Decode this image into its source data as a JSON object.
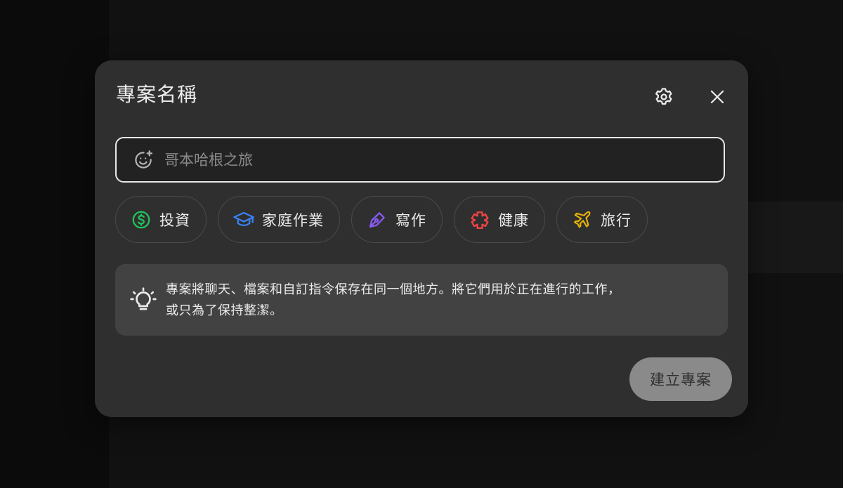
{
  "dialog": {
    "title": "專案名稱",
    "settings_icon": "gear-icon",
    "close_icon": "close-icon"
  },
  "name_field": {
    "value": "",
    "placeholder": "哥本哈根之旅",
    "emoji_icon": "smiley-add-icon"
  },
  "categories": [
    {
      "label": "投資",
      "icon": "dollar-circle-icon",
      "color": "#22c55e"
    },
    {
      "label": "家庭作業",
      "icon": "graduation-cap-icon",
      "color": "#3b82f6"
    },
    {
      "label": "寫作",
      "icon": "pen-nib-icon",
      "color": "#8b5cf6"
    },
    {
      "label": "健康",
      "icon": "medical-cross-icon",
      "color": "#ef4444"
    },
    {
      "label": "旅行",
      "icon": "airplane-icon",
      "color": "#eab308"
    }
  ],
  "info": {
    "icon": "lightbulb-icon",
    "line1": "專案將聊天、檔案和自訂指令保存在同一個地方。將它們用於正在進行的工作，",
    "line2": "或只為了保持整潔。"
  },
  "actions": {
    "create_label": "建立專案"
  },
  "colors": {
    "dialog_bg": "#2f2f2f",
    "info_bg": "#424242",
    "create_button_bg": "#8a8a8a"
  }
}
